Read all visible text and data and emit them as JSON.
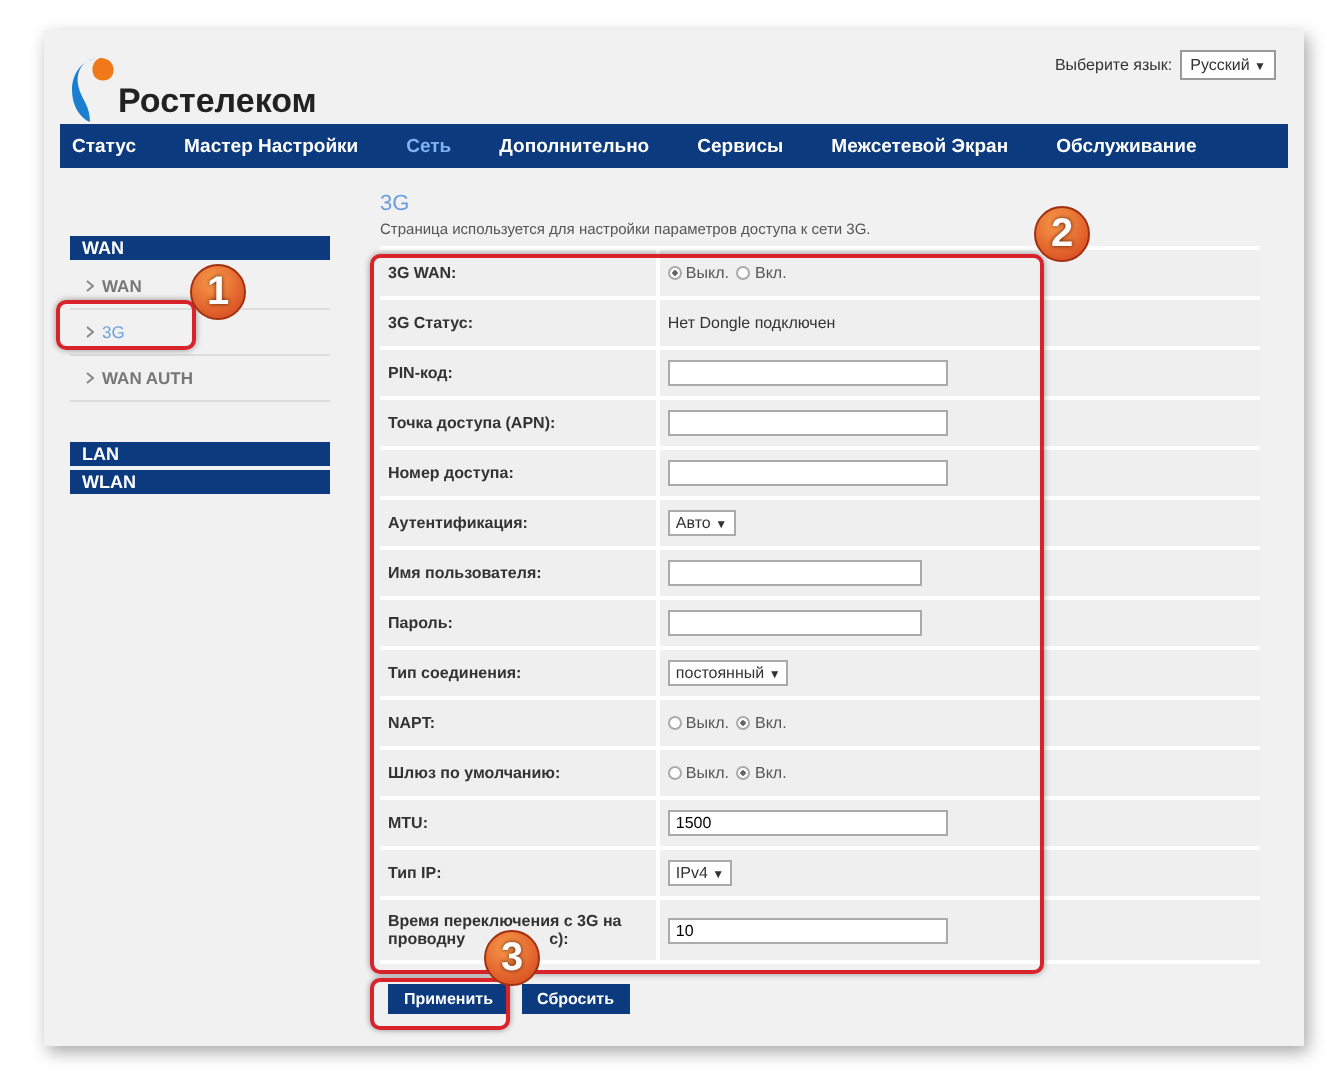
{
  "header": {
    "brand": "Ростелеком",
    "language_label": "Выберите язык:",
    "language": "Русский",
    "language_arrow": "▼"
  },
  "nav": [
    {
      "label": "Статус",
      "selected": false
    },
    {
      "label": "Мастер Настройки",
      "selected": false
    },
    {
      "label": "Сеть",
      "selected": true
    },
    {
      "label": "Дополнительно",
      "selected": false
    },
    {
      "label": "Сервисы",
      "selected": false
    },
    {
      "label": "Межсетевой Экран",
      "selected": false
    },
    {
      "label": "Обслуживание",
      "selected": false
    }
  ],
  "sidebar": [
    {
      "label": "WAN",
      "children": [
        {
          "label": "WAN",
          "selected": false
        },
        {
          "label": "3G",
          "selected": true
        },
        {
          "label": "WAN AUTH",
          "selected": false
        }
      ]
    },
    {
      "label": "LAN"
    },
    {
      "label": "WLAN"
    }
  ],
  "page": {
    "title": "3G",
    "description": "Страница используется для настройки параметров доступа к сети 3G."
  },
  "form": [
    {
      "kind": "radio",
      "label": "3G WAN:",
      "options": [
        {
          "label": "Выкл.",
          "selected": true
        },
        {
          "label": "Вкл.",
          "selected": false
        }
      ]
    },
    {
      "kind": "text",
      "label": "3G Статус:",
      "value": "Нет Dongle подключен"
    },
    {
      "kind": "input",
      "label": "PIN-код:",
      "wide": true
    },
    {
      "kind": "input",
      "label": "Точка доступа (APN):",
      "wide": true
    },
    {
      "kind": "input",
      "label": "Номер доступа:",
      "wide": true
    },
    {
      "kind": "select",
      "label": "Аутентификация:",
      "value": "Авто",
      "arrow": "▼"
    },
    {
      "kind": "input",
      "label": "Имя пользователя:",
      "wide": false
    },
    {
      "kind": "input",
      "label": "Пароль:",
      "wide": false
    },
    {
      "kind": "select",
      "label": "Тип соединения:",
      "value": "постоянный",
      "arrow": "▼"
    },
    {
      "kind": "radio",
      "label": "NAPT:",
      "options": [
        {
          "label": "Выкл.",
          "selected": false
        },
        {
          "label": "Вкл.",
          "selected": true
        }
      ]
    },
    {
      "kind": "radio",
      "label": "Шлюз по умолчанию:",
      "options": [
        {
          "label": "Выкл.",
          "selected": false
        },
        {
          "label": "Вкл.",
          "selected": true
        }
      ]
    },
    {
      "kind": "input",
      "label": "MTU:",
      "value": "1500",
      "wide": true
    },
    {
      "kind": "select",
      "label": "Тип IP:",
      "value": "IPv4",
      "arrow": "▼"
    },
    {
      "kind": "input",
      "label": "Время переключения с 3G на",
      "label_2": "проводну",
      "label_end": "с):",
      "value": "10",
      "wide": true
    }
  ],
  "buttons": [
    "Применить",
    "Сбросить"
  ],
  "annotations": [
    "1",
    "2",
    "3"
  ]
}
